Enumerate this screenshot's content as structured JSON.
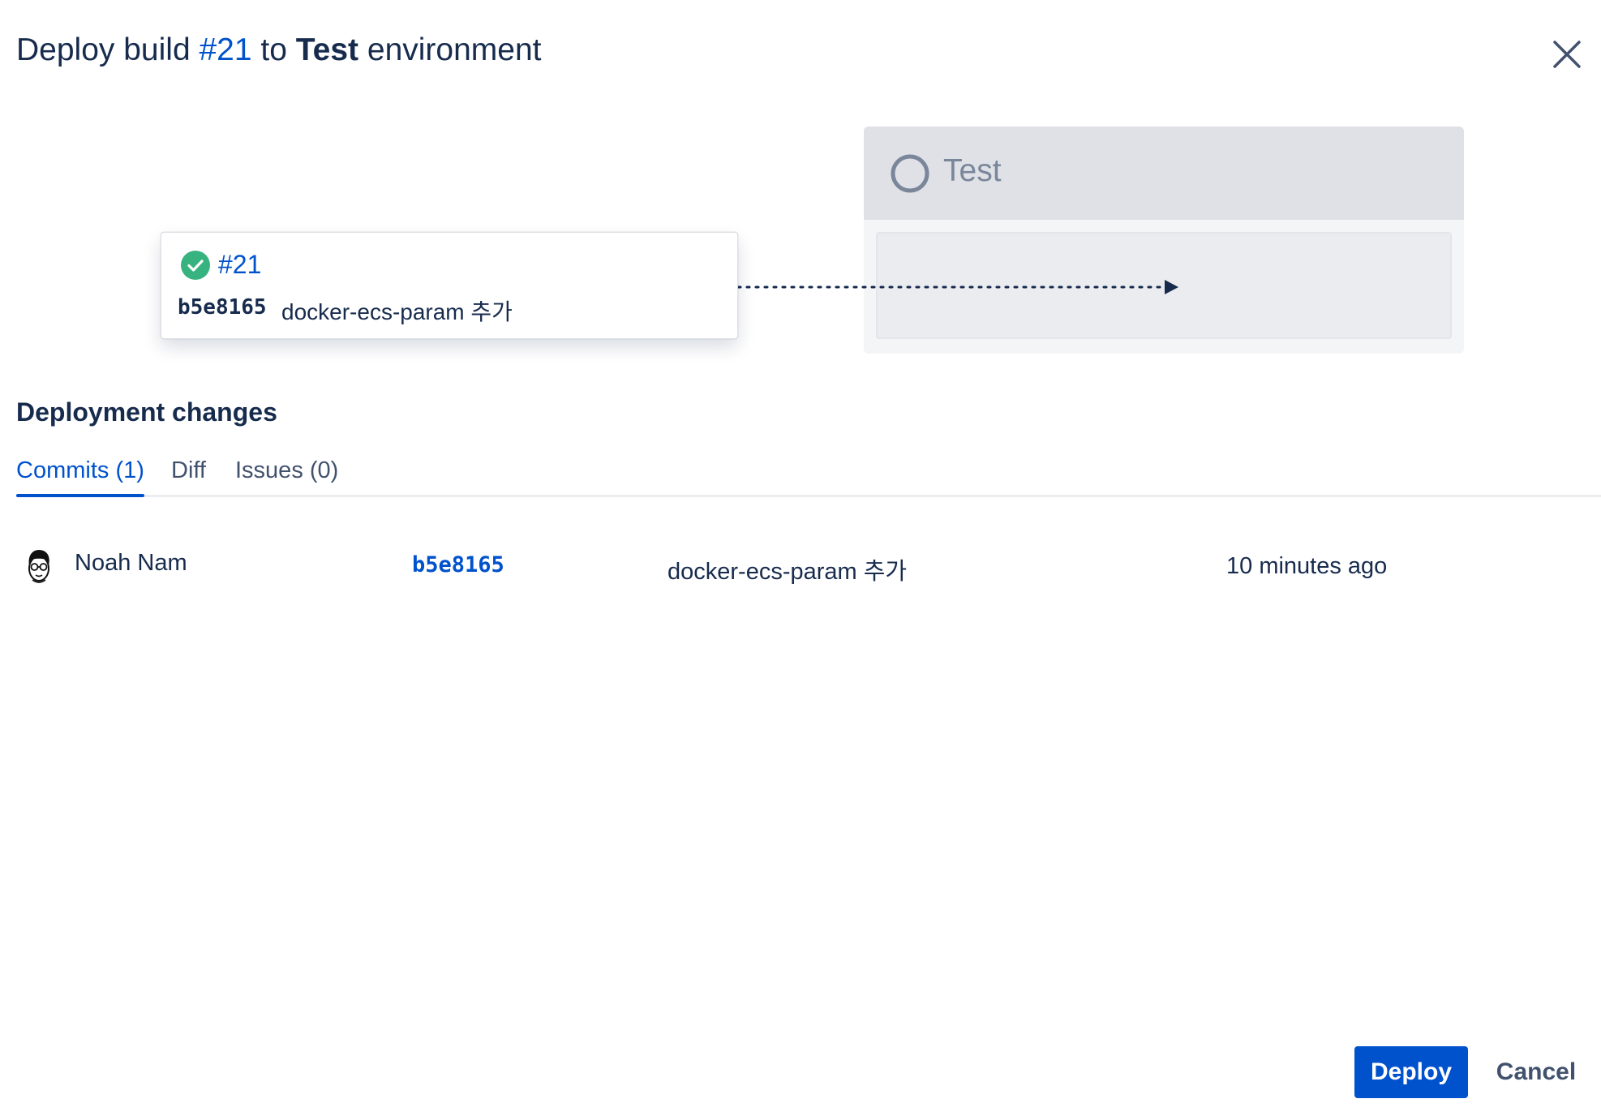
{
  "dialog": {
    "title_prefix": "Deploy build ",
    "build_ref": "#21",
    "title_mid": " to ",
    "env_name": "Test",
    "title_suffix": " environment"
  },
  "icons": {
    "close": "close-icon",
    "build_status": "check-circle-icon",
    "environment_status": "empty-circle-icon",
    "avatar": "user-avatar"
  },
  "colors": {
    "accent": "#0052cc",
    "success": "#36b37e",
    "text": "#172b4d"
  },
  "build_card": {
    "number": "#21",
    "commit_hash": "b5e8165",
    "commit_message": "docker-ecs-param 추가"
  },
  "environment": {
    "name": "Test"
  },
  "changes": {
    "heading": "Deployment changes",
    "tabs": [
      {
        "label": "Commits (1)",
        "active": true
      },
      {
        "label": "Diff",
        "active": false
      },
      {
        "label": "Issues (0)",
        "active": false
      }
    ],
    "commits": [
      {
        "author": "Noah Nam",
        "hash": "b5e8165",
        "message": "docker-ecs-param 추가",
        "time": "10 minutes ago"
      }
    ]
  },
  "footer": {
    "deploy_label": "Deploy",
    "cancel_label": "Cancel"
  }
}
